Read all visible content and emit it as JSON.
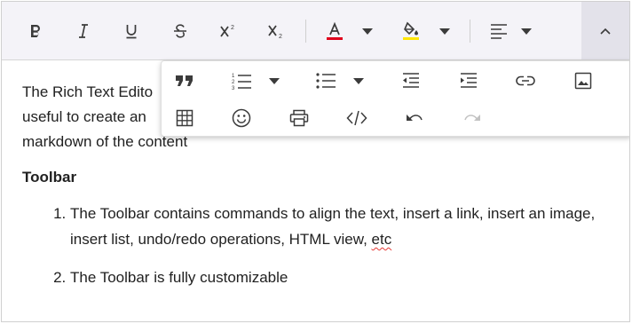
{
  "content": {
    "paragraph_line1": "The Rich Text Edito",
    "paragraph_line2": "useful to create an",
    "paragraph_line3": "markdown of the content",
    "heading": "Toolbar",
    "list_item1_a": "The Toolbar contains commands to align the text, insert a link, insert an image, insert list, undo/redo operations, HTML view, ",
    "list_item1_b": "etc",
    "list_item2": "The Toolbar is fully customizable"
  },
  "colors": {
    "font_color": "#e0001c",
    "background_color": "#ffe600",
    "toolbar_bg": "#f4f3f8",
    "expanded_button_bg": "#e3e2ea"
  },
  "toolbar": {
    "primary_icons": [
      "bold-icon",
      "italic-icon",
      "underline-icon",
      "strikethrough-icon",
      "superscript-icon",
      "subscript-icon",
      "font-color-icon",
      "background-color-icon",
      "align-icon",
      "chevron-up-icon"
    ],
    "overflow_icons": [
      "blockquote-icon",
      "ordered-list-icon",
      "unordered-list-icon",
      "outdent-icon",
      "indent-icon",
      "link-icon",
      "image-icon",
      "table-icon",
      "emoji-icon",
      "print-icon",
      "code-view-icon",
      "undo-icon",
      "redo-icon"
    ]
  }
}
